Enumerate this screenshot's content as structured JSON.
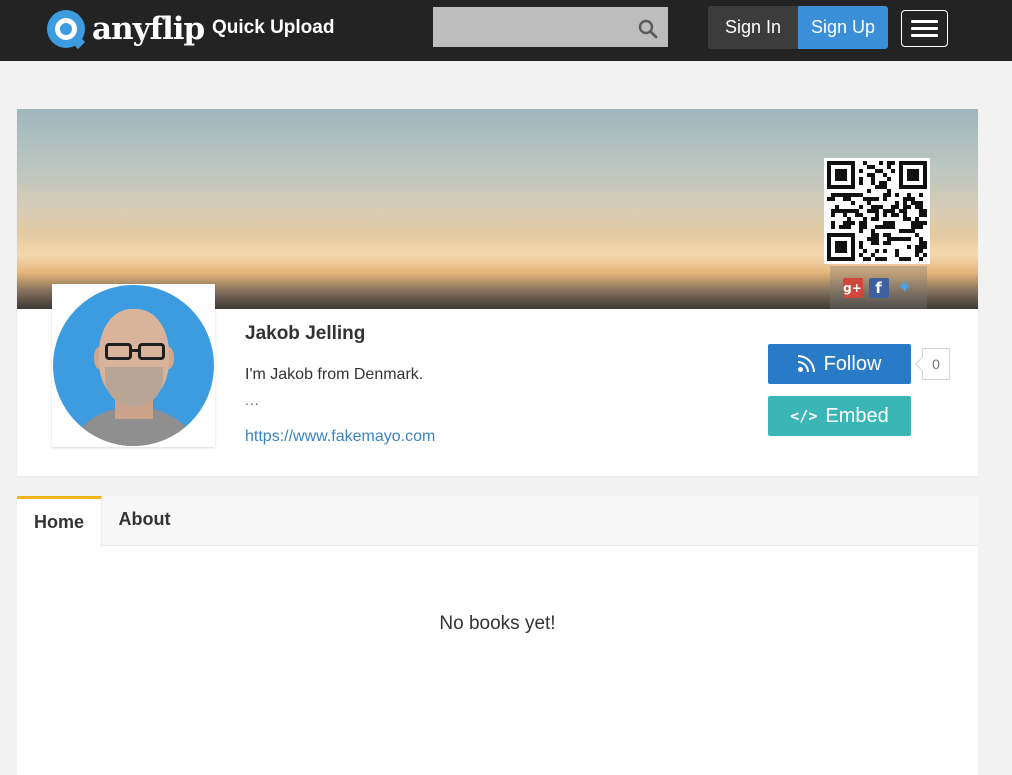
{
  "header": {
    "logo_text": "anyflip",
    "quick_upload": "Quick Upload",
    "search": {
      "value": "",
      "placeholder": ""
    },
    "sign_in": "Sign In",
    "sign_up": "Sign Up"
  },
  "profile": {
    "name": "Jakob Jelling",
    "bio": "I'm Jakob from Denmark.",
    "more": "...",
    "link": "https://www.fakemayo.com",
    "follow_label": "Follow",
    "follow_count": "0",
    "embed_label": "Embed",
    "share_icons": [
      "google-plus-icon",
      "facebook-icon",
      "twitter-icon"
    ]
  },
  "tabs": [
    {
      "label": "Home",
      "active": true
    },
    {
      "label": "About",
      "active": false
    }
  ],
  "content": {
    "empty_message": "No books yet!"
  },
  "colors": {
    "topbar": "#232323",
    "brand_blue": "#3d9be0",
    "sign_up": "#3a8fd8",
    "follow": "#2a7bc7",
    "embed": "#3ab6b6",
    "active_tab_accent": "#f2b51d",
    "link": "#3a84c5"
  }
}
